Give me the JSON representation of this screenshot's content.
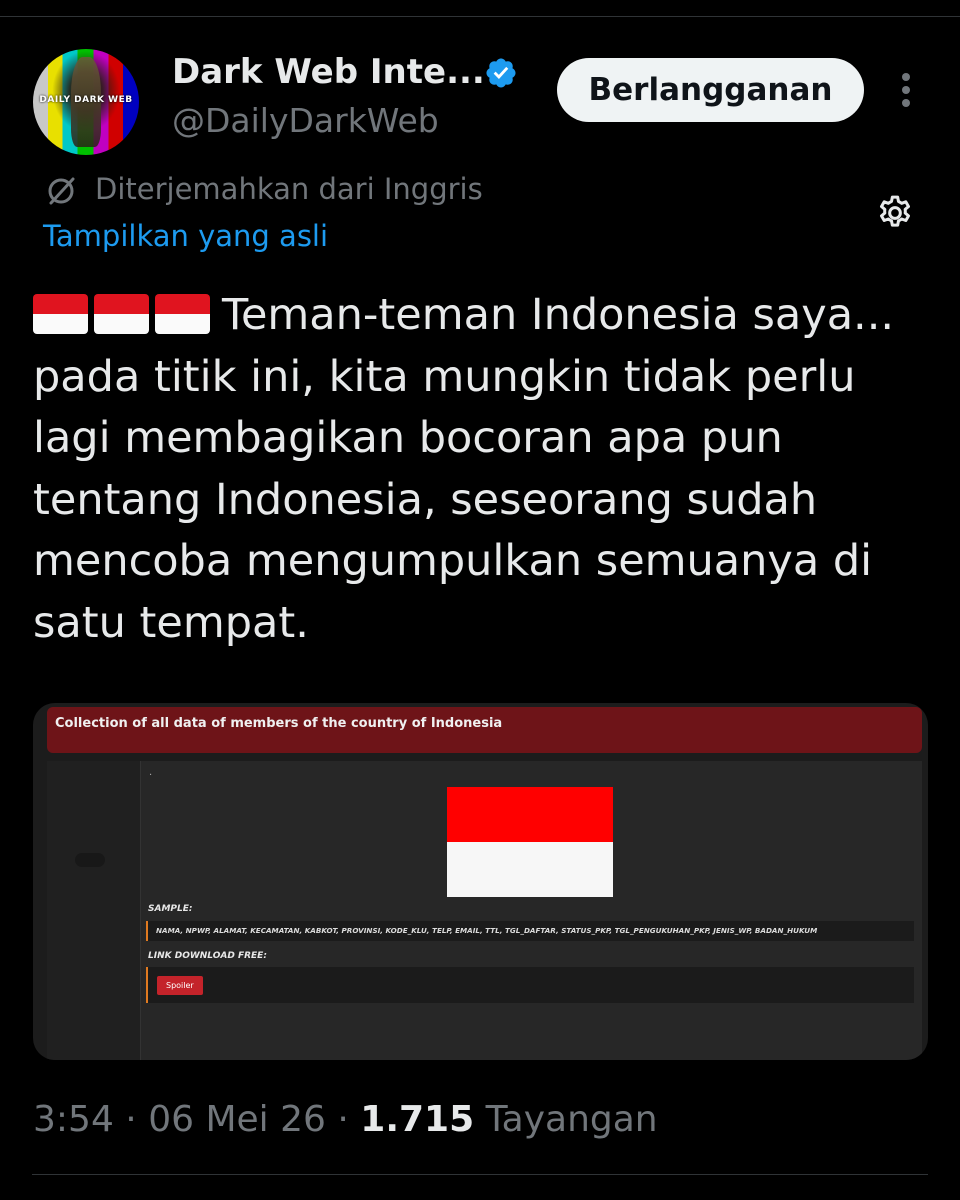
{
  "author": {
    "avatar_text": "DAILY DARK WEB",
    "name": "Dark Web Inte...",
    "handle": "@DailyDarkWeb",
    "verified": true
  },
  "subscribe_label": "Berlangganan",
  "translation": {
    "notice": "Diterjemahkan dari Inggris",
    "show_original": "Tampilkan yang asli"
  },
  "tweet": {
    "flags": [
      "🇮🇩",
      "🇮🇩",
      "🇮🇩"
    ],
    "text": "Teman-teman Indonesia saya... pada titik ini, kita mungkin tidak perlu lagi membagikan bocoran apa pun tentang Indonesia, seseorang sudah mencoba mengumpulkan semuanya di satu tempat."
  },
  "media": {
    "header_title": "Collection of all data of members of the country of Indonesia",
    "dot": ".",
    "sample_label": "SAMPLE:",
    "sample_fields": "NAMA, NPWP, ALAMAT, KECAMATAN, KABKOT, PROVINSI, KODE_KLU, TELP, EMAIL, TTL, TGL_DAFTAR, STATUS_PKP, TGL_PENGUKUHAN_PKP, JENIS_WP, BADAN_HUKUM",
    "download_label": "LINK DOWNLOAD FREE:",
    "spoiler_label": "Spoiler"
  },
  "meta": {
    "time": "3:54",
    "separator": "·",
    "date": "06 Mei 26",
    "views_count": "1.715",
    "views_label": "Tayangan"
  },
  "colors": {
    "background": "#000000",
    "text_primary": "#e7e9ea",
    "text_secondary": "#71767b",
    "link": "#1d9bf0",
    "verified_badge": "#1d9bf0",
    "button_bg": "#eff3f4",
    "media_header": "#6e1418"
  },
  "icons": [
    "verified-badge-icon",
    "more-options-icon",
    "translate-icon",
    "gear-icon"
  ]
}
